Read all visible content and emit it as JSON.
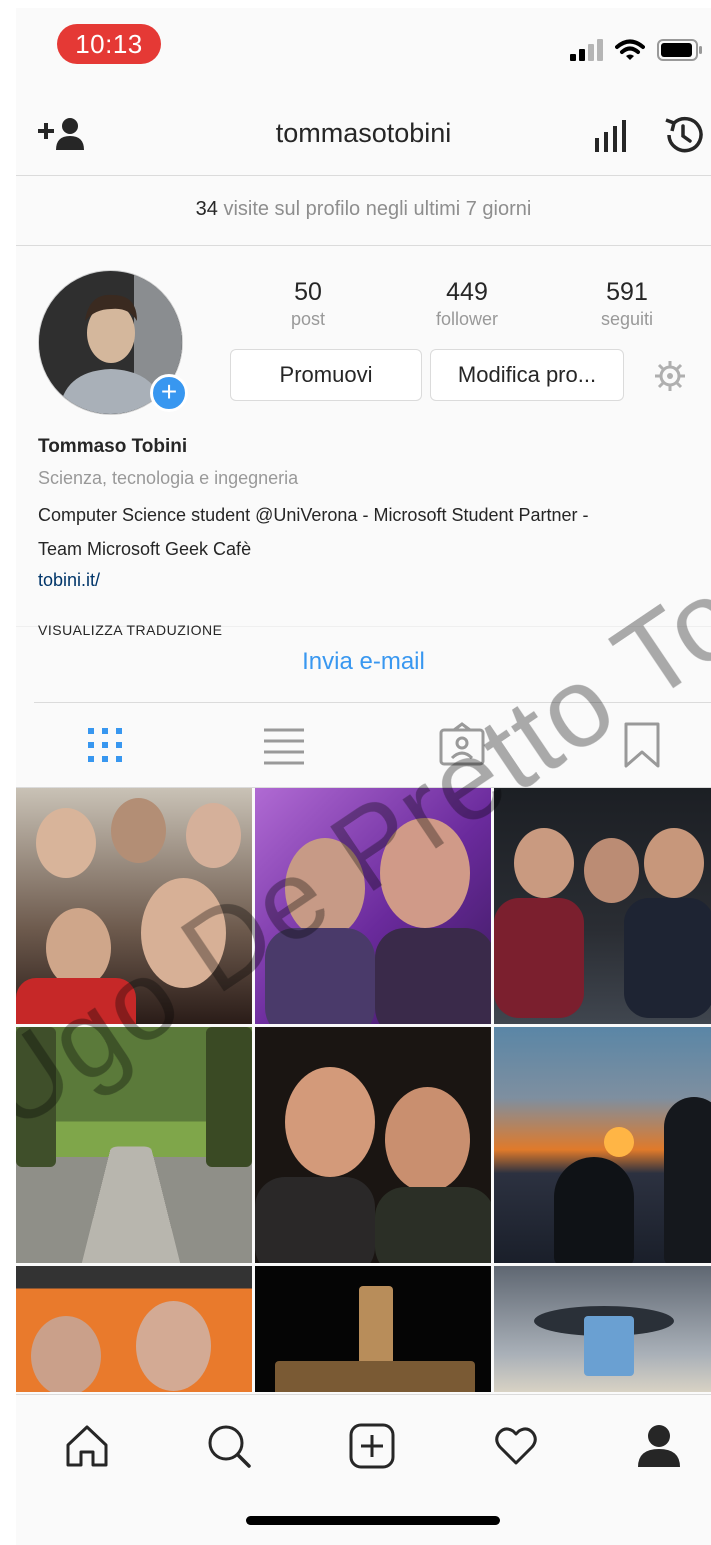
{
  "status_bar": {
    "time": "10:13",
    "time_pill_color": "#e53935"
  },
  "header": {
    "username": "tommasotobini"
  },
  "visits": {
    "count": "34",
    "text": "visite sul profilo negli ultimi 7 giorni"
  },
  "stats": [
    {
      "value": "50",
      "label": "post"
    },
    {
      "value": "449",
      "label": "follower"
    },
    {
      "value": "591",
      "label": "seguiti"
    }
  ],
  "buttons": {
    "promote": "Promuovi",
    "edit_profile": "Modifica pro..."
  },
  "profile": {
    "name": "Tommaso Tobini",
    "category": "Scienza, tecnologia e ingegneria",
    "bio_line1": "Computer Science student @UniVerona - Microsoft Student Partner -",
    "bio_line2": "Team Microsoft Geek Cafè",
    "link": "tobini.it/",
    "translate": "VISUALIZZA TRADUZIONE",
    "email_button": "Invia e-mail"
  },
  "tabs": [
    "grid-icon",
    "list-icon",
    "tagged-icon",
    "saved-icon"
  ],
  "watermark": "Ugo De Pretto Tommaso",
  "colors": {
    "accent": "#3897f0",
    "link": "#003569",
    "separator": "#dbdbdb"
  },
  "bottom_nav": [
    "home-icon",
    "search-icon",
    "add-post-icon",
    "heart-icon",
    "profile-icon"
  ]
}
